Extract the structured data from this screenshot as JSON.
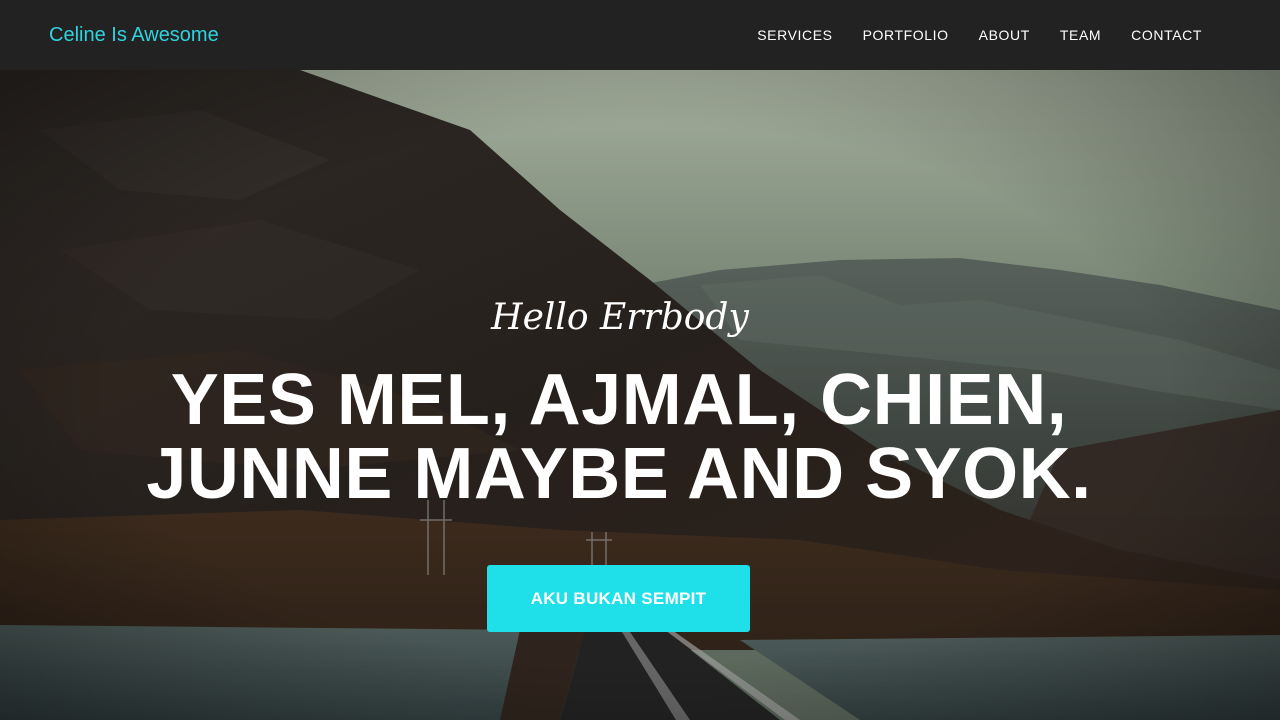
{
  "navbar": {
    "brand": "Celine Is Awesome",
    "links": [
      "SERVICES",
      "PORTFOLIO",
      "ABOUT",
      "TEAM",
      "CONTACT"
    ]
  },
  "hero": {
    "subheading": "Hello Errbody",
    "heading_line1": "YES MEL, AJMAL, CHIEN,",
    "heading_line2": "JUNNE MAYBE AND SYOK.",
    "button_label": "AKU BUKAN SEMPIT"
  },
  "colors": {
    "accent": "#1fe0e8",
    "brand_text": "#2fd2de",
    "navbar_bg": "#222222"
  }
}
